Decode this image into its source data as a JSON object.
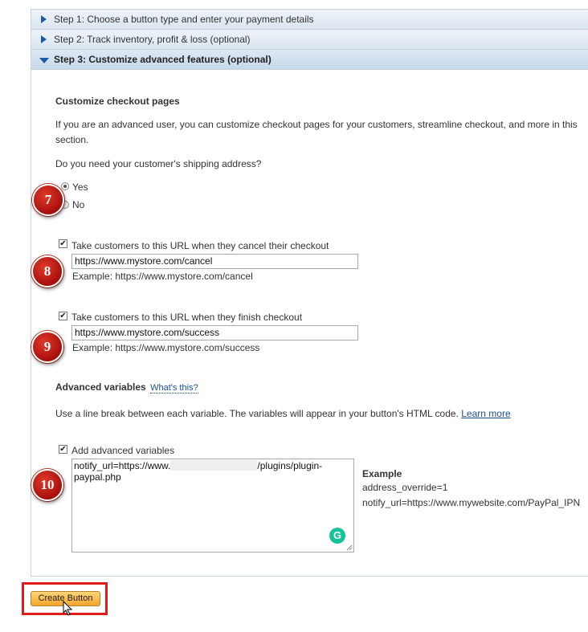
{
  "steps": [
    {
      "label": "Step 1: Choose a button type and enter your payment details"
    },
    {
      "label": "Step 2: Track inventory, profit & loss (optional)"
    },
    {
      "label": "Step 3: Customize advanced features (optional)"
    }
  ],
  "checkout": {
    "heading": "Customize checkout pages",
    "description": "If you are an advanced user, you can customize checkout pages for your customers, streamline checkout, and more in this section.",
    "shipping_question": "Do you need your customer's shipping address?",
    "yes_label": "Yes",
    "no_label": "No"
  },
  "cancel": {
    "label": "Take customers to this URL when they cancel their checkout",
    "value": "https://www.mystore.com/cancel",
    "example": "Example: https://www.mystore.com/cancel"
  },
  "success": {
    "label": "Take customers to this URL when they finish checkout",
    "value": "https://www.mystore.com/success",
    "example": "Example: https://www.mystore.com/success"
  },
  "advanced": {
    "heading": "Advanced variables",
    "whats_this": "What's this?",
    "description": "Use a line break between each variable. The variables will appear in your button's HTML code.",
    "learn_more": "Learn more",
    "checkbox_label": "Add advanced variables",
    "value_prefix": "notify_url=https://www.",
    "value_suffix": "/plugins/plugin-",
    "value_line2": "paypal.php",
    "example_heading": "Example",
    "example_line1": "address_override=1",
    "example_line2": "notify_url=https://www.mywebsite.com/PayPal_IPN"
  },
  "badges": [
    "7",
    "8",
    "9",
    "10"
  ],
  "grammarly_glyph": "G",
  "create_button": "Create Button",
  "colors": {
    "highlight": "#e21b1b",
    "badge": "#b8140f",
    "link": "#1a4f95"
  }
}
